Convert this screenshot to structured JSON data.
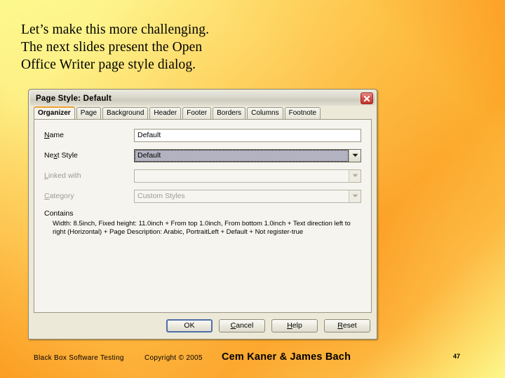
{
  "slide": {
    "title_lines": [
      "Let’s make this more challenging.",
      "The next slides present the Open",
      "Office Writer page style dialog."
    ]
  },
  "dialog": {
    "title": "Page Style: Default",
    "close_icon": "close-icon",
    "tabs": [
      {
        "label": "Organizer",
        "active": true
      },
      {
        "label": "Page",
        "active": false
      },
      {
        "label": "Background",
        "active": false
      },
      {
        "label": "Header",
        "active": false
      },
      {
        "label": "Footer",
        "active": false
      },
      {
        "label": "Borders",
        "active": false
      },
      {
        "label": "Columns",
        "active": false
      },
      {
        "label": "Footnote",
        "active": false
      }
    ],
    "fields": {
      "name": {
        "label": "Name",
        "value": "Default"
      },
      "next_style": {
        "label": "Next Style",
        "value": "Default"
      },
      "linked_with": {
        "label": "Linked with",
        "value": ""
      },
      "category": {
        "label": "Category",
        "value": "Custom Styles"
      }
    },
    "contains": {
      "label": "Contains",
      "text": "Width: 8.5inch, Fixed height: 11.0inch + From top 1.0inch, From bottom 1.0inch + Text direction left to right (Horizontal) + Page Description: Arabic, PortraitLeft + Default + Not register-true"
    },
    "buttons": {
      "ok": "OK",
      "cancel": "Cancel",
      "help": "Help",
      "reset": "Reset"
    }
  },
  "footer": {
    "course": "Black Box Software Testing",
    "copyright": "Copyright © 2005",
    "authors": "Cem Kaner & James Bach",
    "page_number": "47"
  },
  "colors": {
    "background_yellow": "#FDFA8F",
    "background_orange": "#FC9A1E",
    "dialog_face": "#ECE9D8",
    "tab_page": "#F6F4EE",
    "active_tab_accent": "#F0A030",
    "close_button_red": "#C0322B",
    "default_button_border": "#4F6FA8",
    "selected_combo": "#B6B6C4"
  }
}
